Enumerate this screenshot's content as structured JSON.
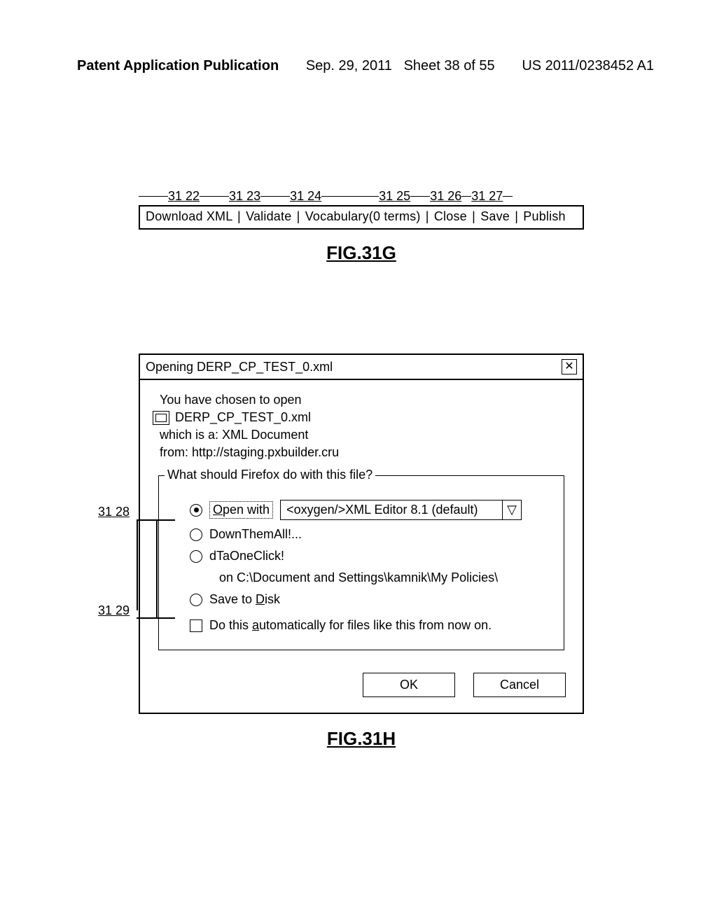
{
  "header": {
    "left": "Patent Application Publication",
    "mid_date": "Sep. 29, 2011",
    "mid_sheet": "Sheet 38 of 55",
    "right": "US 2011/0238452 A1"
  },
  "fig31g": {
    "refs": [
      "31 22",
      "31 23",
      "31 24",
      "31 25",
      "31 26",
      "31 27"
    ],
    "toolbar": {
      "download_xml": "Download XML",
      "validate": "Validate",
      "vocabulary": "Vocabulary(0 terms)",
      "close": "Close",
      "save": "Save",
      "publish": "Publish"
    },
    "caption": "FIG.31G"
  },
  "dialog": {
    "title": "Opening DERP_CP_TEST_0.xml",
    "intro": "You have chosen to open",
    "filename": "DERP_CP_TEST_0.xml",
    "which_is_a": "which is a: XML Document",
    "from": "from: http://staging.pxbuilder.cru",
    "legend": "What should Firefox do with this file?",
    "open_with_label": "Open with",
    "open_with_value": "<oxygen/>XML Editor 8.1 (default)",
    "opt_downthemall": "DownThemAll!...",
    "opt_dtaoneclick": "dTaOneClick!",
    "dtaoneclick_sub": "on C:\\Document and Settings\\kamnik\\My Policies\\",
    "opt_save_to_disk": "Save to Disk",
    "auto_checkbox": "Do this automatically for files like this from now on.",
    "ok": "OK",
    "cancel": "Cancel"
  },
  "callouts": {
    "c3128": "31 28",
    "c3129": "31 29"
  },
  "fig31h_caption": "FIG.31H"
}
